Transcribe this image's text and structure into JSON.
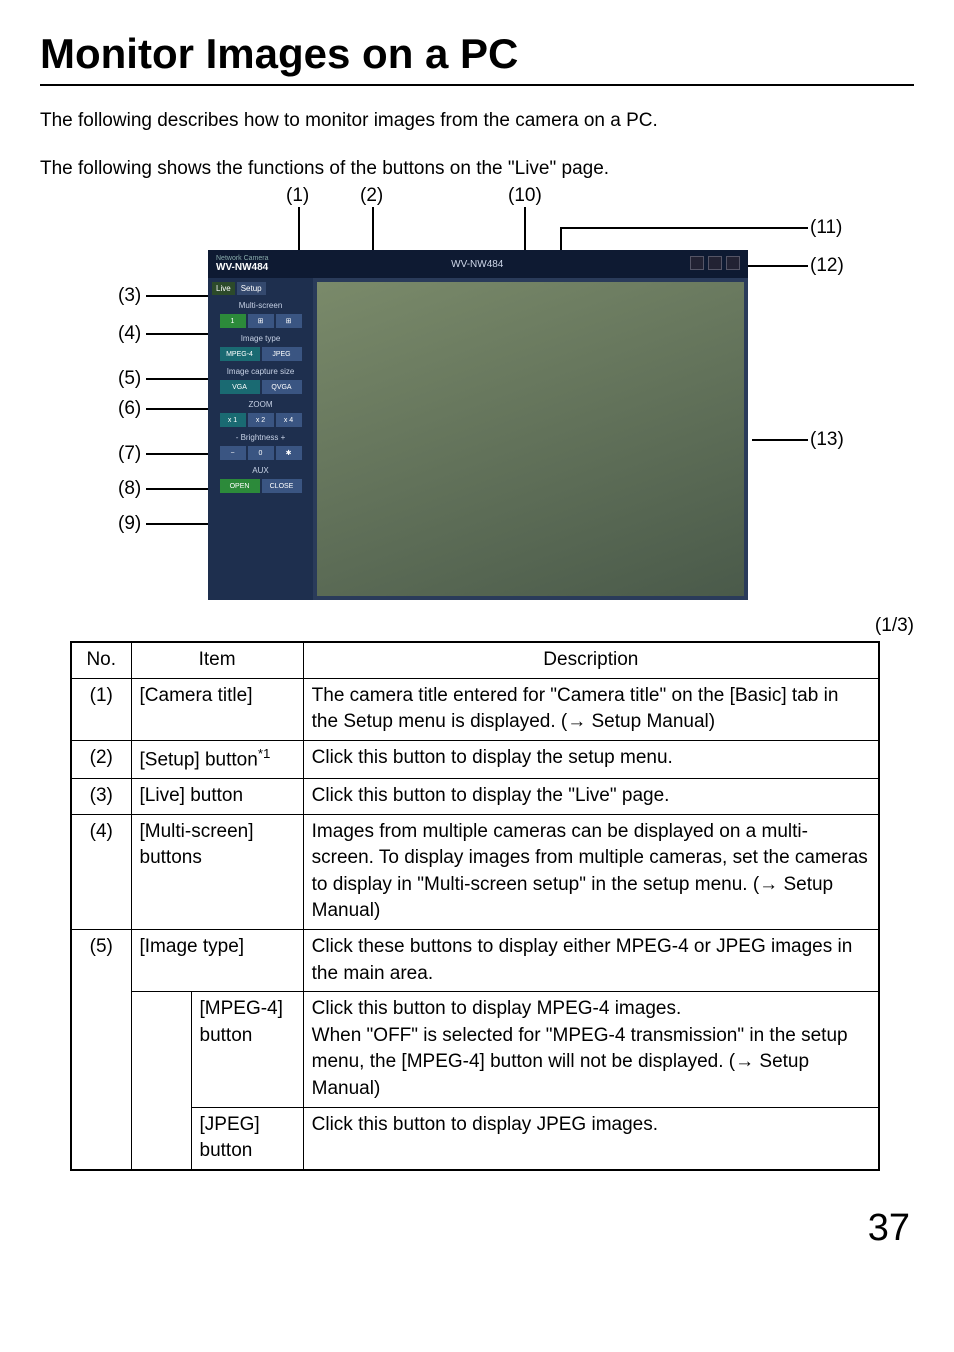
{
  "title": "Monitor Images on a PC",
  "intro1": "The following describes how to monitor images from the camera on a PC.",
  "intro2": "The following shows the functions of the buttons on the \"Live\" page.",
  "callouts": {
    "c1": "(1)",
    "c2": "(2)",
    "c3": "(3)",
    "c4": "(4)",
    "c5": "(5)",
    "c6": "(6)",
    "c7": "(7)",
    "c8": "(8)",
    "c9": "(9)",
    "c10": "(10)",
    "c11": "(11)",
    "c12": "(12)",
    "c13": "(13)"
  },
  "mock": {
    "brand_small": "Network Camera",
    "model": "WV-NW484",
    "tab_live": "Live",
    "tab_setup": "Setup",
    "sec_multiscreen": "Multi-screen",
    "sec_imagetype": "Image type",
    "btn_mpeg4": "MPEG-4",
    "btn_jpeg": "JPEG",
    "sec_capsize": "Image capture size",
    "btn_vga": "VGA",
    "btn_qvga": "QVGA",
    "sec_zoom": "ZOOM",
    "btn_x1": "x 1",
    "btn_x2": "x 2",
    "btn_x4": "x 4",
    "sec_brightness": "-  Brightness  +",
    "btn_minus": "−",
    "btn_zero": "0",
    "btn_star": "✱",
    "sec_aux": "AUX",
    "btn_open": "OPEN",
    "btn_close": "CLOSE"
  },
  "page_counter": "(1/3)",
  "table": {
    "h_no": "No.",
    "h_item": "Item",
    "h_desc": "Description",
    "rows": [
      {
        "no": "(1)",
        "item": "[Camera title]",
        "desc": "The camera title entered for \"Camera title\" on the [Basic] tab in the Setup menu is displayed. (→ Setup Manual)"
      },
      {
        "no": "(2)",
        "item_html": "[Setup] button",
        "item_sup": "*1",
        "desc": "Click this button to display the setup menu."
      },
      {
        "no": "(3)",
        "item": "[Live] button",
        "desc": "Click this button to display the \"Live\" page."
      },
      {
        "no": "(4)",
        "item": "[Multi-screen] buttons",
        "desc": "Images from multiple cameras can be displayed on a multi-screen. To display images from multiple cameras, set the cameras to display in \"Multi-screen setup\" in the setup menu. (→ Setup Manual)"
      },
      {
        "no": "(5)",
        "item": "[Image type]",
        "desc": "Click these buttons to display either MPEG-4 or JPEG images in the main area."
      }
    ],
    "sub5": [
      {
        "item": "[MPEG-4] button",
        "desc": "Click this button to display MPEG-4 images.\nWhen \"OFF\" is selected for \"MPEG-4 transmission\" in the setup menu, the [MPEG-4] button will not be displayed. (→ Setup Manual)"
      },
      {
        "item": "[JPEG] button",
        "desc": "Click this button to display JPEG images."
      }
    ]
  },
  "page_number": "37"
}
